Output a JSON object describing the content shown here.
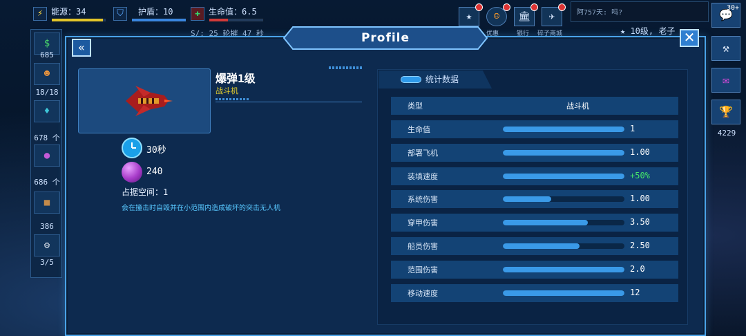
{
  "hud": {
    "energy": {
      "label": "能源：34",
      "fill": 0.95
    },
    "shield": {
      "label": "护盾：10",
      "fill": 1.0
    },
    "hp": {
      "label": "生命值：6.5",
      "fill": 0.35
    },
    "sub": "S/: 25 轮摧 47 秒"
  },
  "top_icons": [
    {
      "icon": "star-icon",
      "label": ""
    },
    {
      "icon": "smiley-icon",
      "label": "优惠"
    },
    {
      "icon": "bank-icon",
      "label": "银行"
    },
    {
      "icon": "plane-icon",
      "label": "碎子商城"
    }
  ],
  "chat": {
    "text": "阿757天: 吗?"
  },
  "level_text": "10级, 老子",
  "left_bar": {
    "counts": [
      "685",
      "18/18",
      "678 个",
      "686 个",
      "386",
      "3/5"
    ]
  },
  "right_bar": {
    "badge": "30+",
    "count": "4229"
  },
  "panel": {
    "title": "Profile"
  },
  "ship": {
    "name": "爆弹1级",
    "class": "战斗机",
    "build_time": "30秒",
    "cost": "240",
    "space_label": "占据空间：1",
    "description": "会在撞击时自毁并在小范围内造成破坏的突击无人机"
  },
  "stats": {
    "header": "统计数据",
    "type_label": "类型",
    "type_value": "战斗机",
    "rows": [
      {
        "label": "生命值",
        "value": "1",
        "fill": 1.0,
        "good": false
      },
      {
        "label": "部署飞机",
        "value": "1.00",
        "fill": 1.0,
        "good": false
      },
      {
        "label": "装填速度",
        "value": "+50%",
        "fill": 1.0,
        "good": true
      },
      {
        "label": "系统伤害",
        "value": "1.00",
        "fill": 0.4,
        "good": false
      },
      {
        "label": "穿甲伤害",
        "value": "3.50",
        "fill": 0.7,
        "good": false
      },
      {
        "label": "船员伤害",
        "value": "2.50",
        "fill": 0.63,
        "good": false
      },
      {
        "label": "范围伤害",
        "value": "2.0",
        "fill": 1.0,
        "good": false
      },
      {
        "label": "移动速度",
        "value": "12",
        "fill": 1.0,
        "good": false
      }
    ]
  },
  "colors": {
    "panel_border": "#4aa3e8",
    "bar_fill": "#3a9ae8",
    "good_value": "#45e86a",
    "class_text": "#e8d12c",
    "desc_text": "#58c8ff"
  }
}
